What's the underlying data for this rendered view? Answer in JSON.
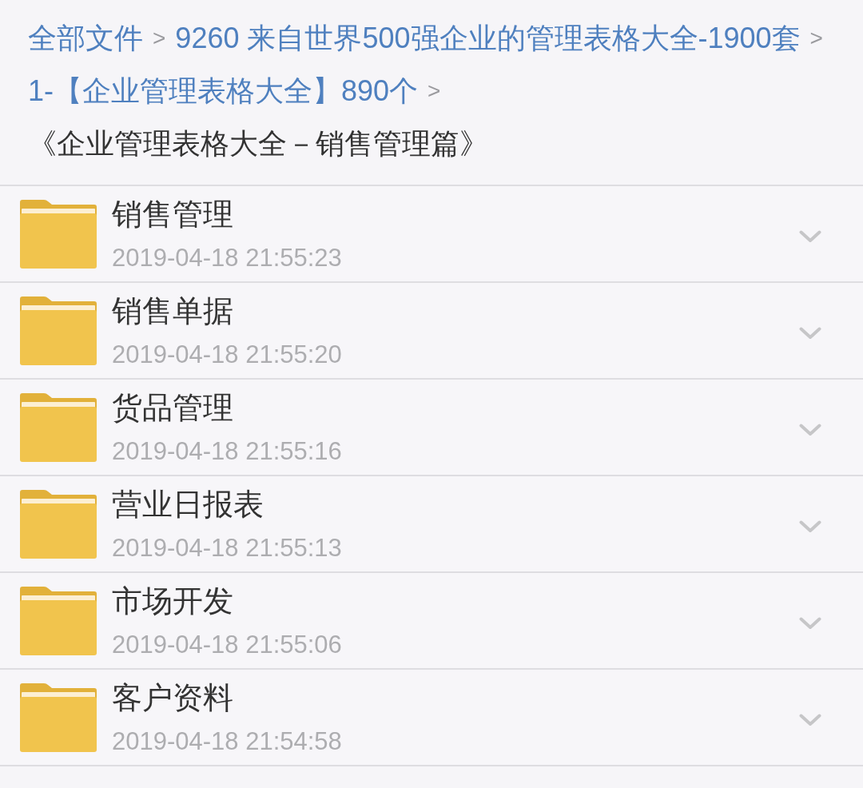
{
  "breadcrumb": [
    {
      "kind": "link",
      "label": "全部文件"
    },
    {
      "kind": "separator",
      "label": ">"
    },
    {
      "kind": "link",
      "label": "9260 来自世界500强企业的管理表格大全-1900套"
    },
    {
      "kind": "separator",
      "label": ">"
    },
    {
      "kind": "link",
      "label": "1-【企业管理表格大全】890个"
    },
    {
      "kind": "separator",
      "label": ">"
    },
    {
      "kind": "current",
      "label": "《企业管理表格大全－销售管理篇》"
    }
  ],
  "folders": [
    {
      "name": "销售管理",
      "modified": "2019-04-18 21:55:23"
    },
    {
      "name": "销售单据",
      "modified": "2019-04-18 21:55:20"
    },
    {
      "name": "货品管理",
      "modified": "2019-04-18 21:55:16"
    },
    {
      "name": "营业日报表",
      "modified": "2019-04-18 21:55:13"
    },
    {
      "name": "市场开发",
      "modified": "2019-04-18 21:55:06"
    },
    {
      "name": "客户资料",
      "modified": "2019-04-18 21:54:58"
    }
  ]
}
